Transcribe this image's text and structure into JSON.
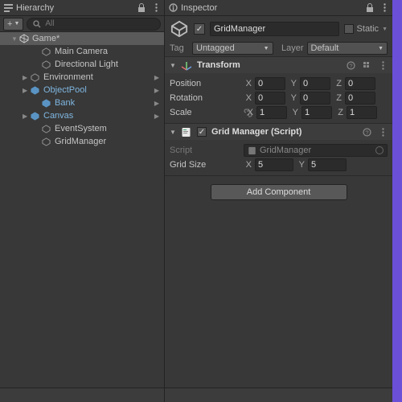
{
  "hierarchy": {
    "panel_title": "Hierarchy",
    "plus": "+",
    "search_placeholder": "All",
    "scene": {
      "name": "Game*"
    },
    "items": [
      {
        "name": "Main Camera"
      },
      {
        "name": "Directional Light"
      },
      {
        "name": "Environment"
      },
      {
        "name": "ObjectPool"
      },
      {
        "name": "Bank"
      },
      {
        "name": "Canvas"
      },
      {
        "name": "EventSystem"
      },
      {
        "name": "GridManager"
      }
    ]
  },
  "inspector": {
    "panel_title": "Inspector",
    "go": {
      "active": "✓",
      "name": "GridManager",
      "static_label": "Static",
      "tag_label": "Tag",
      "tag_value": "Untagged",
      "layer_label": "Layer",
      "layer_value": "Default"
    },
    "transform": {
      "title": "Transform",
      "position": {
        "label": "Position",
        "x": "0",
        "y": "0",
        "z": "0"
      },
      "rotation": {
        "label": "Rotation",
        "x": "0",
        "y": "0",
        "z": "0"
      },
      "scale": {
        "label": "Scale",
        "x": "1",
        "y": "1",
        "z": "1"
      }
    },
    "script": {
      "title": "Grid Manager (Script)",
      "script_label": "Script",
      "script_value": "GridManager",
      "grid_label": "Grid Size",
      "x": "5",
      "y": "5"
    },
    "add_component": "Add Component"
  },
  "axes": {
    "x": "X",
    "y": "Y",
    "z": "Z"
  }
}
